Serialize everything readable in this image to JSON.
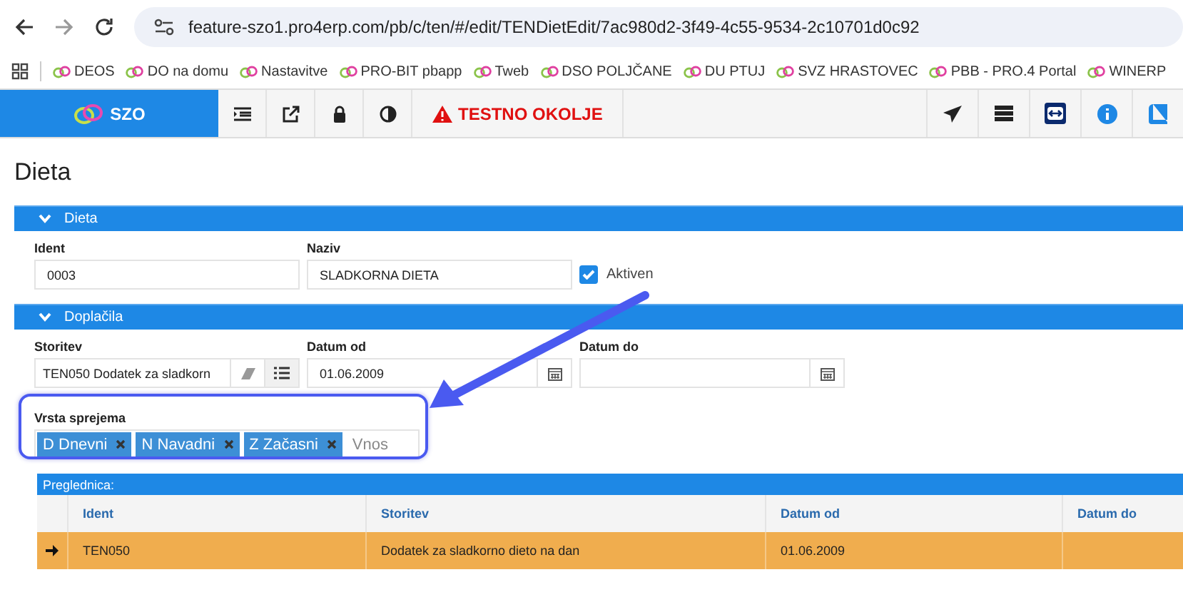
{
  "browser": {
    "url": "feature-szo1.pro4erp.com/pb/c/ten/#/edit/TENDietEdit/7ac980d2-3f49-4c55-9534-2c10701d0c92",
    "bookmarks": [
      "DEOS",
      "DO na domu",
      "Nastavitve",
      "PRO-BIT pbapp",
      "Tweb",
      "DSO POLJČANE",
      "DU PTUJ",
      "SVZ HRASTOVEC",
      "PBB - PRO.4 Portal",
      "WINERP"
    ]
  },
  "app_bar": {
    "title": "SZO",
    "warning": "TESTNO OKOLJE"
  },
  "page_title": "Dieta",
  "dieta": {
    "title": "Dieta",
    "expanded": true,
    "ident": {
      "label": "Ident",
      "value": "0003"
    },
    "naziv": {
      "label": "Naziv",
      "value": "SLADKORNA DIETA"
    },
    "aktiven": {
      "label": "Aktiven",
      "checked": true
    }
  },
  "doplacila": {
    "title": "Doplačila",
    "expanded": true,
    "storitev": {
      "label": "Storitev",
      "value": "TEN050 Dodatek za sladkorn"
    },
    "datum_od": {
      "label": "Datum od",
      "value": "01.06.2009"
    },
    "datum_do": {
      "label": "Datum do"
    }
  },
  "vrsta_sprejema": {
    "label": "Vrsta sprejema",
    "placeholder": "Vnos",
    "tags": [
      "D Dnevni",
      "N Navadni",
      "Z Začasni"
    ]
  },
  "table": {
    "title": "Preglednica:",
    "columns": [
      "Ident",
      "Storitev",
      "Datum od",
      "Datum do"
    ],
    "rows": [
      {
        "selected": true,
        "cells": [
          "TEN050",
          "Dodatek za sladkorno dieto na dan",
          "01.06.2009"
        ]
      }
    ]
  }
}
